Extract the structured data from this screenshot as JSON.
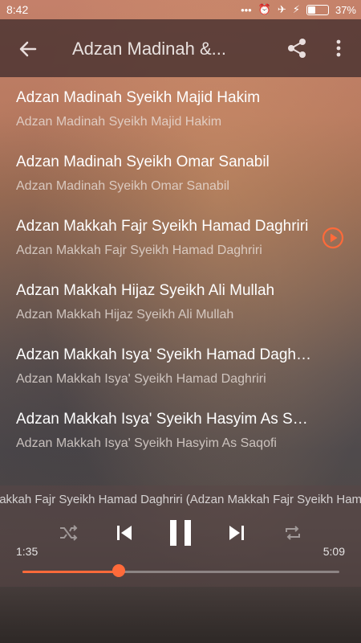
{
  "status_bar": {
    "time": "8:42",
    "battery": "37%"
  },
  "app_bar": {
    "title": "Adzan Madinah &..."
  },
  "tracks": [
    {
      "title": "Adzan Madinah Syeikh Majid Hakim",
      "subtitle": "Adzan Madinah Syeikh Majid Hakim",
      "playing": false
    },
    {
      "title": "Adzan Madinah Syeikh Omar Sanabil",
      "subtitle": "Adzan Madinah Syeikh Omar Sanabil",
      "playing": false
    },
    {
      "title": "Adzan Makkah Fajr Syeikh Hamad Daghriri",
      "subtitle": "Adzan Makkah Fajr Syeikh Hamad Daghriri",
      "playing": true
    },
    {
      "title": "Adzan Makkah Hijaz Syeikh Ali Mullah",
      "subtitle": "Adzan Makkah Hijaz Syeikh Ali Mullah",
      "playing": false
    },
    {
      "title": "Adzan Makkah Isya' Syeikh Hamad Daghriri",
      "subtitle": "Adzan Makkah Isya' Syeikh Hamad Daghriri",
      "playing": false
    },
    {
      "title": "Adzan Makkah Isya' Syeikh Hasyim As Saqofi",
      "subtitle": "Adzan Makkah Isya' Syeikh Hasyim As Saqofi",
      "playing": false
    }
  ],
  "player": {
    "now_playing": "Adzan Makkah Fajr Syeikh Hamad Daghriri (Adzan Makkah Fajr Syeikh Hamad Daghriri)",
    "elapsed": "1:35",
    "duration": "5:09",
    "progress": 0.31
  },
  "colors": {
    "accent": "#ff6a3a",
    "appbar": "#412d2d"
  }
}
